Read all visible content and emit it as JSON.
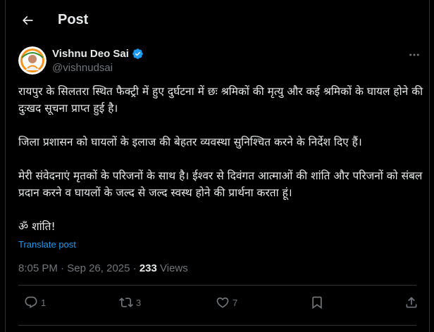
{
  "header": {
    "title": "Post",
    "back_icon": "arrow-left-icon"
  },
  "author": {
    "name": "Vishnu Deo Sai",
    "handle": "@vishnudsai",
    "verified_icon": "verified-badge-icon",
    "verified_color": "#1d9bf0",
    "more_icon": "more-horizontal-icon"
  },
  "post": {
    "paragraphs": [
      "रायपुर के सिलतरा स्थित फैक्ट्री में हुए दुर्घटना में छः श्रमिकों की मृत्यु और कई श्रमिकों के घायल होने की दुःखद सूचना प्राप्त हुई है।",
      "जिला प्रशासन को घायलों के इलाज की बेहतर व्यवस्था सुनिश्चित करने के निर्देश दिए हैं।",
      "मेरी संवेदनाएं मृतकों के परिजनों के साथ है। ईश्वर से दिवंगत आत्माओं की शांति और परिजनों को संबल प्रदान करने व घायलों के जल्द से जल्द स्वस्थ होने की प्रार्थना करता हूं।",
      "ॐ शांति!"
    ],
    "translate_label": "Translate post"
  },
  "meta": {
    "time": "8:05 PM",
    "separator": "·",
    "date": "Sep 26, 2025",
    "views_count": "233",
    "views_label": "Views"
  },
  "actions": {
    "reply": {
      "icon": "reply-icon",
      "count": "1"
    },
    "repost": {
      "icon": "repost-icon",
      "count": "3"
    },
    "like": {
      "icon": "heart-icon",
      "count": "7"
    },
    "bookmark": {
      "icon": "bookmark-icon"
    },
    "share": {
      "icon": "share-icon"
    }
  },
  "colors": {
    "background": "#000000",
    "text": "#e7e9ea",
    "secondary": "#71767b",
    "accent": "#1d9bf0",
    "border": "#2f3336"
  }
}
